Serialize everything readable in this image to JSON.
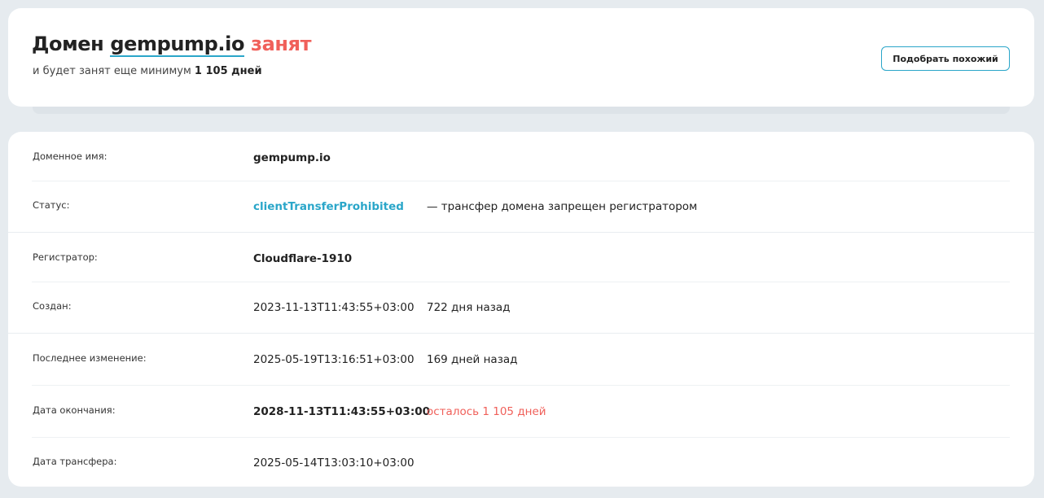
{
  "header": {
    "title_prefix": "Домен",
    "domain": "gempump.io",
    "status_word": "занят",
    "subtitle_prefix": "и будет занят еще минимум",
    "subtitle_days": "1 105 дней",
    "similar_button_label": "Подобрать похожий"
  },
  "info": {
    "rows": [
      {
        "label": "Доменное имя:",
        "value": "gempump.io",
        "note": ""
      },
      {
        "label": "Статус:",
        "value": "clientTransferProhibited",
        "note": "— трансфер домена запрещен регистратором"
      },
      {
        "label": "Регистратор:",
        "value": "Cloudflare-1910",
        "note": ""
      },
      {
        "label": "Создан:",
        "value": "2023-11-13T11:43:55+03:00",
        "note": "722 дня назад"
      },
      {
        "label": "Последнее изменение:",
        "value": "2025-05-19T13:16:51+03:00",
        "note": "169 дней назад"
      },
      {
        "label": "Дата окончания:",
        "value": "2028-11-13T11:43:55+03:00",
        "note": "осталось 1 105 дней"
      },
      {
        "label": "Дата трансфера:",
        "value": "2025-05-14T13:03:10+03:00",
        "note": ""
      }
    ]
  },
  "colors": {
    "accent": "#2aa6c9",
    "danger": "#f0605a",
    "background": "#e6ebef"
  }
}
